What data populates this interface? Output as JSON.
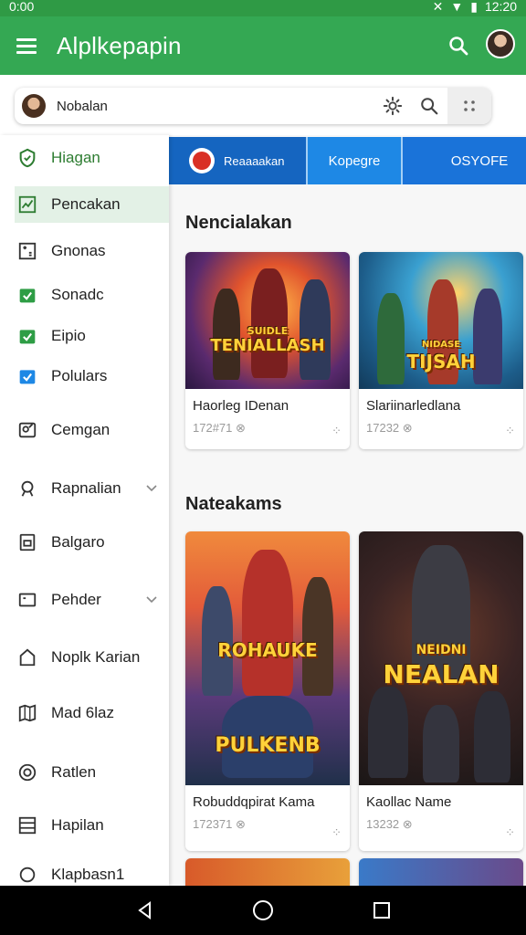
{
  "status_bar": {
    "time": "12:20",
    "left_text": "0:00"
  },
  "app_bar": {
    "title": "Alplkepapin",
    "menu_icon": "menu-icon",
    "search_icon": "search-icon",
    "avatar_icon": "avatar"
  },
  "search_card": {
    "text": "Nobalan",
    "settings_icon": "gear-icon",
    "search_icon": "search-icon",
    "grid_icon": "grid-icon"
  },
  "sidebar": {
    "items": [
      {
        "label": "Hiagan",
        "icon": "shield-icon"
      },
      {
        "label": "Pencakan",
        "icon": "chart-icon"
      },
      {
        "label": "Gnonas",
        "icon": "gamepad-icon"
      },
      {
        "label": "Sonadc",
        "icon": "check-icon"
      },
      {
        "label": "Eipio",
        "icon": "check-icon"
      },
      {
        "label": "Polulars",
        "icon": "check-icon"
      },
      {
        "label": "Cemgan",
        "icon": "people-icon"
      },
      {
        "label": "Rapnalian",
        "icon": "pin-icon"
      },
      {
        "label": "Balgaro",
        "icon": "square-icon"
      },
      {
        "label": "Pehder",
        "icon": "tv-icon"
      },
      {
        "label": "Noplk Karian",
        "icon": "house-icon"
      },
      {
        "label": "Mad 6laz",
        "icon": "book-icon"
      },
      {
        "label": "Ratlen",
        "icon": "target-icon"
      },
      {
        "label": "Hapilan",
        "icon": "list-icon"
      },
      {
        "label": "Klapbasn1",
        "icon": "gear-icon"
      }
    ]
  },
  "tabs": [
    {
      "label": "Reaaaakan"
    },
    {
      "label": "Kopegre"
    },
    {
      "label": "OSYOFE"
    }
  ],
  "sections": [
    {
      "title": "Nencialakan",
      "cards": [
        {
          "art_title": "TENIALLASH",
          "art_sub": "SUIDLE",
          "name": "Haorleg IDenan",
          "meta": "172#71 ⊗"
        },
        {
          "art_title": "TIJSAH",
          "art_sub": "NIDASE",
          "name": "Slariinarledlana",
          "meta": "17232 ⊗"
        }
      ]
    },
    {
      "title": "Nateakams",
      "cards": [
        {
          "art_title": "ROHAUKE",
          "art_sub": "PULKENB",
          "name": "Robuddqpirat Kama",
          "meta": "172371 ⊗"
        },
        {
          "art_title": "NEALAN",
          "art_sub": "NEIDNI",
          "name": "Kaollac Name",
          "meta": "13232 ⊗"
        }
      ]
    }
  ],
  "colors": {
    "app_bar": "#34a853",
    "status_bar": "#2f9a45",
    "tab_bar": "#1a73d9",
    "active_nav": "#e3f1e6"
  }
}
